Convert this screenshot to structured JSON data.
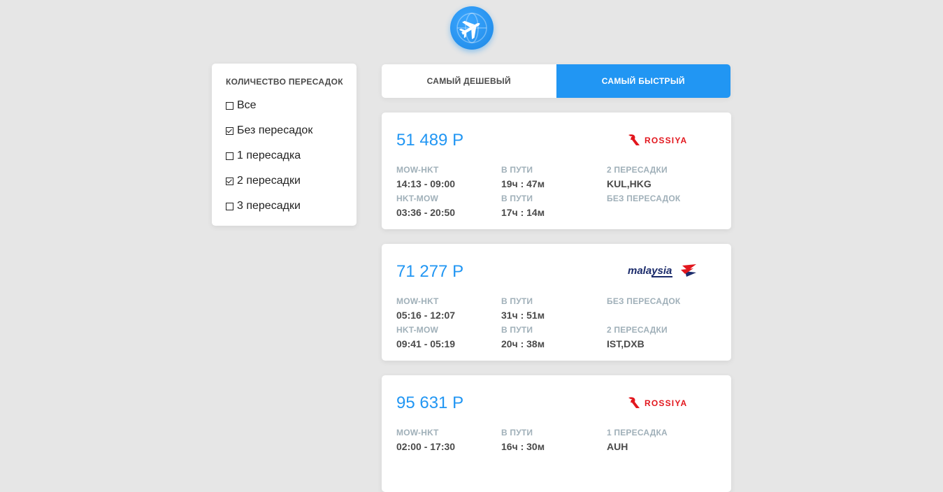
{
  "logo": {
    "icon": "airplane-globe-icon"
  },
  "filter": {
    "title": "КОЛИЧЕСТВО ПЕРЕСАДОК",
    "options": [
      {
        "label": "Все",
        "checked": false
      },
      {
        "label": "Без пересадок",
        "checked": true
      },
      {
        "label": "1 пересадка",
        "checked": false
      },
      {
        "label": "2 пересадки",
        "checked": true
      },
      {
        "label": "3 пересадки",
        "checked": false
      }
    ]
  },
  "tabs": [
    {
      "label": "САМЫЙ ДЕШЕВЫЙ",
      "active": false
    },
    {
      "label": "САМЫЙ БЫСТРЫЙ",
      "active": true
    }
  ],
  "tickets": [
    {
      "price": "51 489 Р",
      "airline": "ROSSIYA",
      "segments": [
        {
          "route": "MOW-HKT",
          "times": "14:13 - 09:00",
          "duration_label": "В ПУТИ",
          "duration": "19ч : 47м",
          "stops_label": "2 ПЕРЕСАДКИ",
          "stops": "KUL,HKG"
        },
        {
          "route": "HKT-MOW",
          "times": "03:36 - 20:50",
          "duration_label": "В ПУТИ",
          "duration": "17ч : 14м",
          "stops_label": "БЕЗ ПЕРЕСАДОК",
          "stops": ""
        }
      ]
    },
    {
      "price": "71 277 Р",
      "airline": "malaysia",
      "segments": [
        {
          "route": "MOW-HKT",
          "times": "05:16 - 12:07",
          "duration_label": "В ПУТИ",
          "duration": "31ч : 51м",
          "stops_label": "БЕЗ ПЕРЕСАДОК",
          "stops": ""
        },
        {
          "route": "HKT-MOW",
          "times": "09:41 - 05:19",
          "duration_label": "В ПУТИ",
          "duration": "20ч : 38м",
          "stops_label": "2 ПЕРЕСАДКИ",
          "stops": "IST,DXB"
        }
      ]
    },
    {
      "price": "95 631 Р",
      "airline": "ROSSIYA",
      "segments": [
        {
          "route": "MOW-HKT",
          "times": "02:00 - 17:30",
          "duration_label": "В ПУТИ",
          "duration": "16ч : 30м",
          "stops_label": "1 ПЕРЕСАДКА",
          "stops": "AUH"
        }
      ]
    }
  ],
  "colors": {
    "accent": "#2196f3",
    "rossiya_red": "#e2161d",
    "malaysia_navy": "#1b2b6b"
  }
}
